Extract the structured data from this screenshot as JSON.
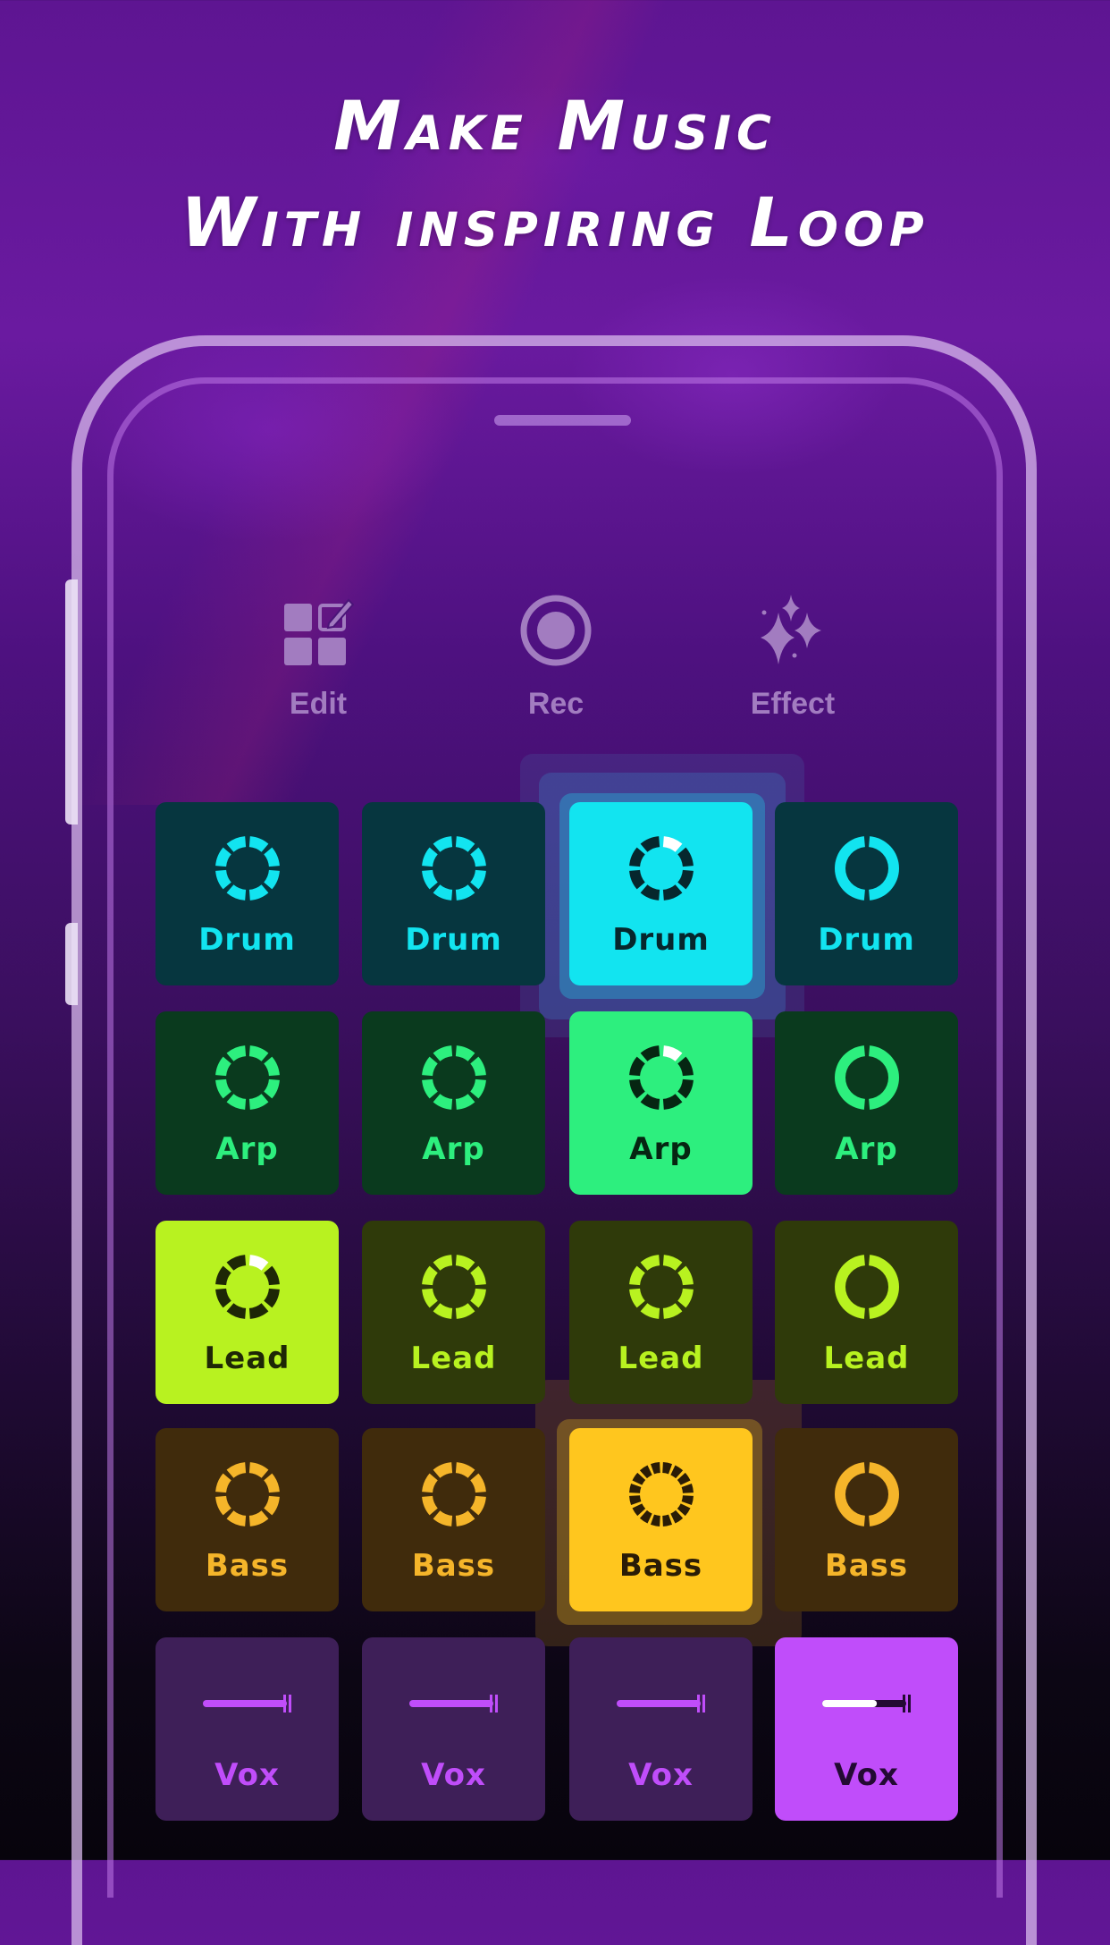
{
  "headline": {
    "line1": "Make Music",
    "line2": "With inspiring Loop"
  },
  "toolbar": {
    "items": [
      {
        "id": "edit",
        "label": "Edit",
        "icon": "edit-grid-icon"
      },
      {
        "id": "rec",
        "label": "Rec",
        "icon": "record-icon"
      },
      {
        "id": "effect",
        "label": "Effect",
        "icon": "sparkles-icon"
      }
    ]
  },
  "colors": {
    "drum": "#12e4f0",
    "arp": "#2def7e",
    "lead": "#b8f220",
    "bass": "#f5b52a",
    "bass_active": "#ffc61e",
    "vox": "#c04dfa",
    "toolbar": "#a27cc0"
  },
  "pad_grid": {
    "rows": [
      {
        "category": "drum",
        "pads": [
          {
            "label": "Drum",
            "active": false,
            "icon": "dashed-ring-icon"
          },
          {
            "label": "Drum",
            "active": false,
            "icon": "dashed-ring-icon"
          },
          {
            "label": "Drum",
            "active": true,
            "icon": "dashed-ring-icon"
          },
          {
            "label": "Drum",
            "active": false,
            "icon": "split-ring-icon"
          }
        ]
      },
      {
        "category": "arp",
        "pads": [
          {
            "label": "Arp",
            "active": false,
            "icon": "dashed-ring-icon"
          },
          {
            "label": "Arp",
            "active": false,
            "icon": "dashed-ring-icon"
          },
          {
            "label": "Arp",
            "active": true,
            "icon": "dashed-ring-icon"
          },
          {
            "label": "Arp",
            "active": false,
            "icon": "split-ring-icon"
          }
        ]
      },
      {
        "category": "lead",
        "pads": [
          {
            "label": "Lead",
            "active": true,
            "icon": "dashed-ring-icon"
          },
          {
            "label": "Lead",
            "active": false,
            "icon": "dashed-ring-icon"
          },
          {
            "label": "Lead",
            "active": false,
            "icon": "dashed-ring-icon"
          },
          {
            "label": "Lead",
            "active": false,
            "icon": "split-ring-icon"
          }
        ]
      },
      {
        "category": "bass",
        "pads": [
          {
            "label": "Bass",
            "active": false,
            "icon": "dashed-ring-icon"
          },
          {
            "label": "Bass",
            "active": false,
            "icon": "dashed-ring-icon"
          },
          {
            "label": "Bass",
            "active": true,
            "icon": "fine-dashed-ring-icon"
          },
          {
            "label": "Bass",
            "active": false,
            "icon": "split-ring-icon"
          }
        ]
      },
      {
        "category": "vox",
        "pads": [
          {
            "label": "Vox",
            "active": false,
            "icon": "vox-line-icon"
          },
          {
            "label": "Vox",
            "active": false,
            "icon": "vox-line-icon"
          },
          {
            "label": "Vox",
            "active": false,
            "icon": "vox-line-icon"
          },
          {
            "label": "Vox",
            "active": true,
            "icon": "vox-line-icon",
            "progress": 0.65
          }
        ]
      }
    ]
  }
}
